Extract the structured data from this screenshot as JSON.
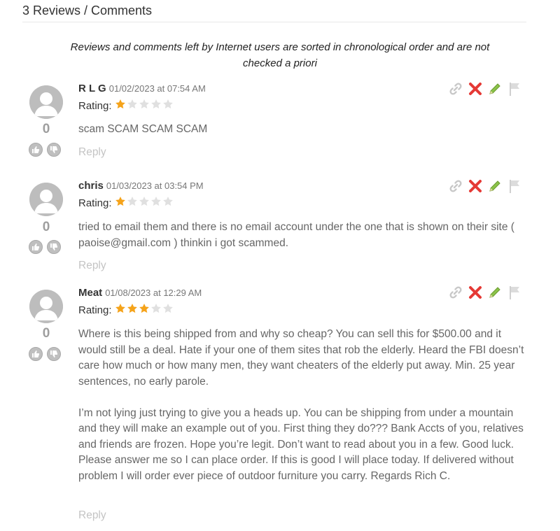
{
  "section": {
    "title": "3 Reviews / Comments",
    "notice": "Reviews and comments left by Internet users are sorted in chronological order and are not checked a priori"
  },
  "labels": {
    "rating": "Rating:",
    "reply": "Reply"
  },
  "colors": {
    "star_filled": "#f5a31a",
    "star_empty": "#e0e0e0",
    "link_icon": "#c8c8c8",
    "delete_icon": "#e53935",
    "edit_icon": "#8bc34a",
    "flag_icon": "#cfcfcf",
    "vote_icon": "#bfbfbf"
  },
  "icons": [
    "avatar-icon",
    "thumbs-up-icon",
    "thumbs-down-icon",
    "link-icon",
    "delete-icon",
    "edit-icon",
    "flag-icon",
    "star-icon"
  ],
  "comments": [
    {
      "author": "R L G",
      "date": "01/02/2023 at 07:54 AM",
      "rating": 1,
      "votes": "0",
      "paragraphs": [
        "scam SCAM SCAM SCAM"
      ]
    },
    {
      "author": "chris",
      "date": "01/03/2023 at 03:54 PM",
      "rating": 1,
      "votes": "0",
      "paragraphs": [
        "tried to email them and there is no email account under the one that is shown on their site ( paoise@gmail.com ) thinkin i got scammed."
      ]
    },
    {
      "author": "Meat",
      "date": "01/08/2023 at 12:29 AM",
      "rating": 3,
      "votes": "0",
      "paragraphs": [
        "Where is this being shipped from and why so cheap? You can sell this for $500.00 and it would still be a deal. Hate if your one of them sites that rob the elderly. Heard the FBI doesn’t care how much or how many men, they want cheaters of the elderly put away. Min. 25 year sentences, no early parole.",
        "I’m not lying just trying to give you a heads up. You can be shipping from under a mountain and they will make an example out of you. First thing they do??? Bank Accts of you, relatives and friends are frozen. Hope you’re legit. Don’t want to read about you in a few. Good luck. Please answer me so I can place order. If this is good I will place today. If delivered without problem I will order ever piece of outdoor furniture you carry. Regards Rich C."
      ]
    }
  ]
}
